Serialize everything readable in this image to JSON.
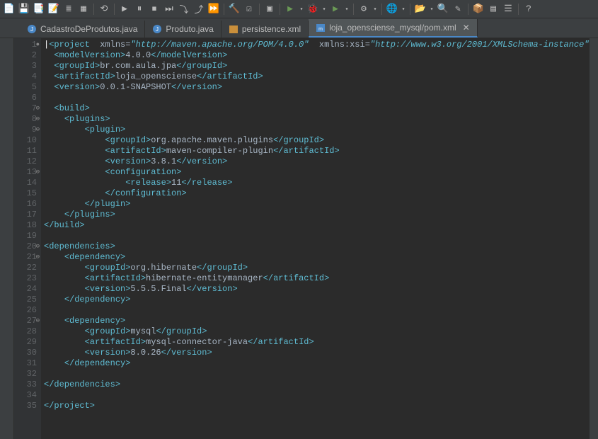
{
  "tabs": [
    {
      "label": "CadastroDeProdutos.java",
      "active": false,
      "icon": "java"
    },
    {
      "label": "Produto.java",
      "active": false,
      "icon": "java"
    },
    {
      "label": "persistence.xml",
      "active": false,
      "icon": "xml"
    },
    {
      "label": "loja_opensciense_mysql/pom.xml",
      "active": true,
      "icon": "maven"
    }
  ],
  "toolbar_icons": [
    "new",
    "save",
    "save-all",
    "edit",
    "list",
    "doc",
    "sep",
    "back",
    "sep",
    "play",
    "pause",
    "stop",
    "skip",
    "step",
    "step2",
    "resume",
    "sep",
    "build",
    "tasks",
    "sep",
    "term",
    "sep",
    "run-green",
    "dropdown",
    "debug",
    "dropdown",
    "run2",
    "dropdown",
    "sep",
    "ext",
    "dropdown",
    "sep",
    "globe",
    "dropdown",
    "sep",
    "open",
    "dropdown",
    "search",
    "wand",
    "sep",
    "pkg",
    "grid",
    "eq",
    "sep",
    "help"
  ],
  "code": {
    "lines": [
      {
        "n": 1,
        "f": "●",
        "html": "<span class='cursor'>|</span><span class='tag'>&lt;project</span>  <span class='attr'>xmlns</span><span class='txt'>=</span><span class='kwd'>\"http://maven.apache.org/POM/4.0.0\"</span>  <span class='attr'>xmlns:xsi</span><span class='txt'>=</span><span class='kwd'>\"http://www.w3.org/2001/XMLSchema-instance\"</span>  <span class='attr'>xsi:sch</span>"
      },
      {
        "n": 2,
        "html": "  <span class='tag'>&lt;modelVersion&gt;</span><span class='txt'>4.0.0</span><span class='tag'>&lt;/modelVersion&gt;</span>"
      },
      {
        "n": 3,
        "html": "  <span class='tag'>&lt;groupId&gt;</span><span class='txt'>br.com.aula.jpa</span><span class='tag'>&lt;/groupId&gt;</span>"
      },
      {
        "n": 4,
        "html": "  <span class='tag'>&lt;artifactId&gt;</span><span class='txt'>loja_opensciense</span><span class='tag'>&lt;/artifactId&gt;</span>"
      },
      {
        "n": 5,
        "html": "  <span class='tag'>&lt;version&gt;</span><span class='txt'>0.0.1-SNAPSHOT</span><span class='tag'>&lt;/version&gt;</span>"
      },
      {
        "n": 6,
        "html": ""
      },
      {
        "n": 7,
        "f": "⊖",
        "html": "  <span class='tag'>&lt;build&gt;</span>"
      },
      {
        "n": 8,
        "f": "⊖",
        "html": "    <span class='tag'>&lt;plugins&gt;</span>"
      },
      {
        "n": 9,
        "f": "⊖",
        "html": "        <span class='tag'>&lt;plugin&gt;</span>"
      },
      {
        "n": 10,
        "html": "            <span class='tag'>&lt;groupId&gt;</span><span class='txt'>org.apache.maven.plugins</span><span class='tag'>&lt;/groupId&gt;</span>"
      },
      {
        "n": 11,
        "html": "            <span class='tag'>&lt;artifactId&gt;</span><span class='txt'>maven-compiler-plugin</span><span class='tag'>&lt;/artifactId&gt;</span>"
      },
      {
        "n": 12,
        "html": "            <span class='tag'>&lt;version&gt;</span><span class='txt'>3.8.1</span><span class='tag'>&lt;/version&gt;</span>"
      },
      {
        "n": 13,
        "f": "⊖",
        "html": "            <span class='tag'>&lt;configuration&gt;</span>"
      },
      {
        "n": 14,
        "html": "                <span class='tag'>&lt;release&gt;</span><span class='txt'>11</span><span class='tag'>&lt;/release&gt;</span>"
      },
      {
        "n": 15,
        "html": "            <span class='tag'>&lt;/configuration&gt;</span>"
      },
      {
        "n": 16,
        "html": "        <span class='tag'>&lt;/plugin&gt;</span>"
      },
      {
        "n": 17,
        "html": "    <span class='tag'>&lt;/plugins&gt;</span>"
      },
      {
        "n": 18,
        "html": "<span class='tag'>&lt;/build&gt;</span>"
      },
      {
        "n": 19,
        "html": ""
      },
      {
        "n": 20,
        "f": "⊖",
        "html": "<span class='tag'>&lt;dependencies&gt;</span>"
      },
      {
        "n": 21,
        "f": "⊖",
        "html": "    <span class='tag'>&lt;dependency&gt;</span>"
      },
      {
        "n": 22,
        "html": "        <span class='tag'>&lt;groupId&gt;</span><span class='txt'>org.hibernate</span><span class='tag'>&lt;/groupId&gt;</span>"
      },
      {
        "n": 23,
        "html": "        <span class='tag'>&lt;artifactId&gt;</span><span class='txt'>hibernate-entitymanager</span><span class='tag'>&lt;/artifactId&gt;</span>"
      },
      {
        "n": 24,
        "html": "        <span class='tag'>&lt;version&gt;</span><span class='txt'>5.5.5.Final</span><span class='tag'>&lt;/version&gt;</span>"
      },
      {
        "n": 25,
        "html": "    <span class='tag'>&lt;/dependency&gt;</span>"
      },
      {
        "n": 26,
        "html": ""
      },
      {
        "n": 27,
        "f": "⊖",
        "html": "    <span class='tag'>&lt;dependency&gt;</span>"
      },
      {
        "n": 28,
        "html": "        <span class='tag'>&lt;groupId&gt;</span><span class='txt'>mysql</span><span class='tag'>&lt;/groupId&gt;</span>"
      },
      {
        "n": 29,
        "html": "        <span class='tag'>&lt;artifactId&gt;</span><span class='txt'>mysql-connector-java</span><span class='tag'>&lt;/artifactId&gt;</span>"
      },
      {
        "n": 30,
        "html": "        <span class='tag'>&lt;version&gt;</span><span class='txt'>8.0.26</span><span class='tag'>&lt;/version&gt;</span>"
      },
      {
        "n": 31,
        "html": "    <span class='tag'>&lt;/dependency&gt;</span>"
      },
      {
        "n": 32,
        "html": ""
      },
      {
        "n": 33,
        "html": "<span class='tag'>&lt;/dependencies&gt;</span>"
      },
      {
        "n": 34,
        "html": ""
      },
      {
        "n": 35,
        "html": "<span class='tag'>&lt;/project&gt;</span>"
      }
    ]
  }
}
